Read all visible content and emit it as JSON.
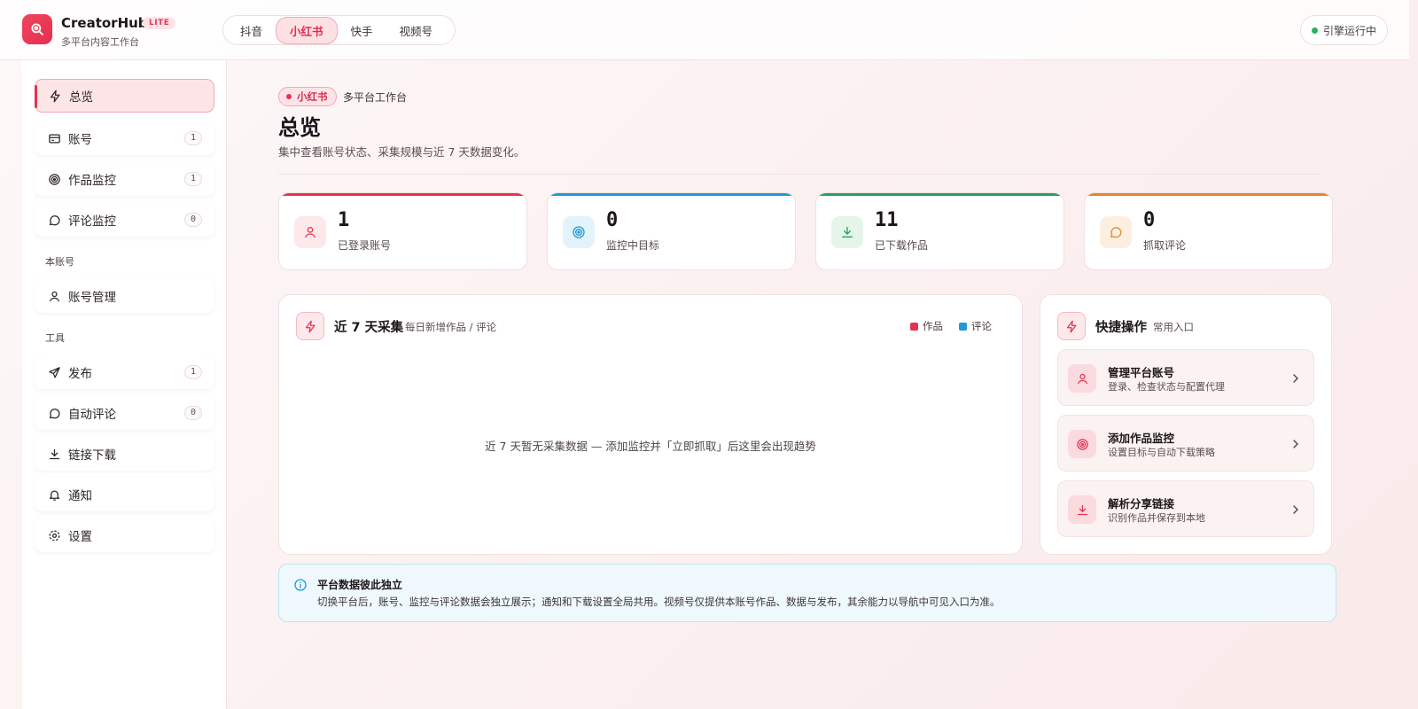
{
  "app": {
    "name": "CreatorHub",
    "badge": "LITE",
    "subtitle": "多平台内容工作台"
  },
  "platform_tabs": [
    {
      "label": "抖音",
      "active": false
    },
    {
      "label": "小红书",
      "active": true
    },
    {
      "label": "快手",
      "active": false
    },
    {
      "label": "视频号",
      "active": false
    }
  ],
  "engine_status": {
    "label": "引擎运行中",
    "color": "#22b35a"
  },
  "sidebar": {
    "items": [
      {
        "label": "总览",
        "icon": "bolt-icon",
        "count": null,
        "active": true
      },
      {
        "label": "账号",
        "icon": "card-icon",
        "count": "1"
      },
      {
        "label": "作品监控",
        "icon": "target-icon",
        "count": "1"
      },
      {
        "label": "评论监控",
        "icon": "comment-icon",
        "count": "0"
      }
    ],
    "section_account": "本账号",
    "account_items": [
      {
        "label": "账号管理",
        "icon": "user-icon"
      }
    ],
    "section_tools": "工具",
    "tool_items": [
      {
        "label": "发布",
        "icon": "send-icon",
        "count": "1"
      },
      {
        "label": "自动评论",
        "icon": "comment-icon",
        "count": "0"
      },
      {
        "label": "链接下载",
        "icon": "download-icon"
      },
      {
        "label": "通知",
        "icon": "bell-icon"
      },
      {
        "label": "设置",
        "icon": "gear-icon"
      }
    ]
  },
  "page": {
    "badge": "小红书",
    "crumb": "多平台工作台",
    "title": "总览",
    "description": "集中查看账号状态、采集规模与近 7 天数据变化。"
  },
  "stats": [
    {
      "value": "1",
      "label": "已登录账号",
      "color": "#e5334f",
      "icon": "user-icon"
    },
    {
      "value": "0",
      "label": "监控中目标",
      "color": "#1e9bd7",
      "icon": "target-icon"
    },
    {
      "value": "11",
      "label": "已下载作品",
      "color": "#23a35a",
      "icon": "download-icon"
    },
    {
      "value": "0",
      "label": "抓取评论",
      "color": "#e0892a",
      "icon": "comment-icon"
    }
  ],
  "trend_panel": {
    "title": "近 7 天采集",
    "subtitle": "每日新增作品 / 评论",
    "legend": [
      {
        "label": "作品",
        "color": "#e5334f"
      },
      {
        "label": "评论",
        "color": "#1e9bd7"
      }
    ],
    "empty_message": "近 7 天暂无采集数据 — 添加监控并「立即抓取」后这里会出现趋势"
  },
  "quick_panel": {
    "title": "快捷操作",
    "subtitle": "常用入口",
    "items": [
      {
        "title": "管理平台账号",
        "desc": "登录、检查状态与配置代理",
        "icon": "user-icon"
      },
      {
        "title": "添加作品监控",
        "desc": "设置目标与自动下载策略",
        "icon": "target-icon"
      },
      {
        "title": "解析分享链接",
        "desc": "识别作品并保存到本地",
        "icon": "download-icon"
      }
    ]
  },
  "notice": {
    "title": "平台数据彼此独立",
    "text": "切换平台后，账号、监控与评论数据会独立展示；通知和下载设置全局共用。视频号仅提供本账号作品、数据与发布，其余能力以导航中可见入口为准。"
  }
}
